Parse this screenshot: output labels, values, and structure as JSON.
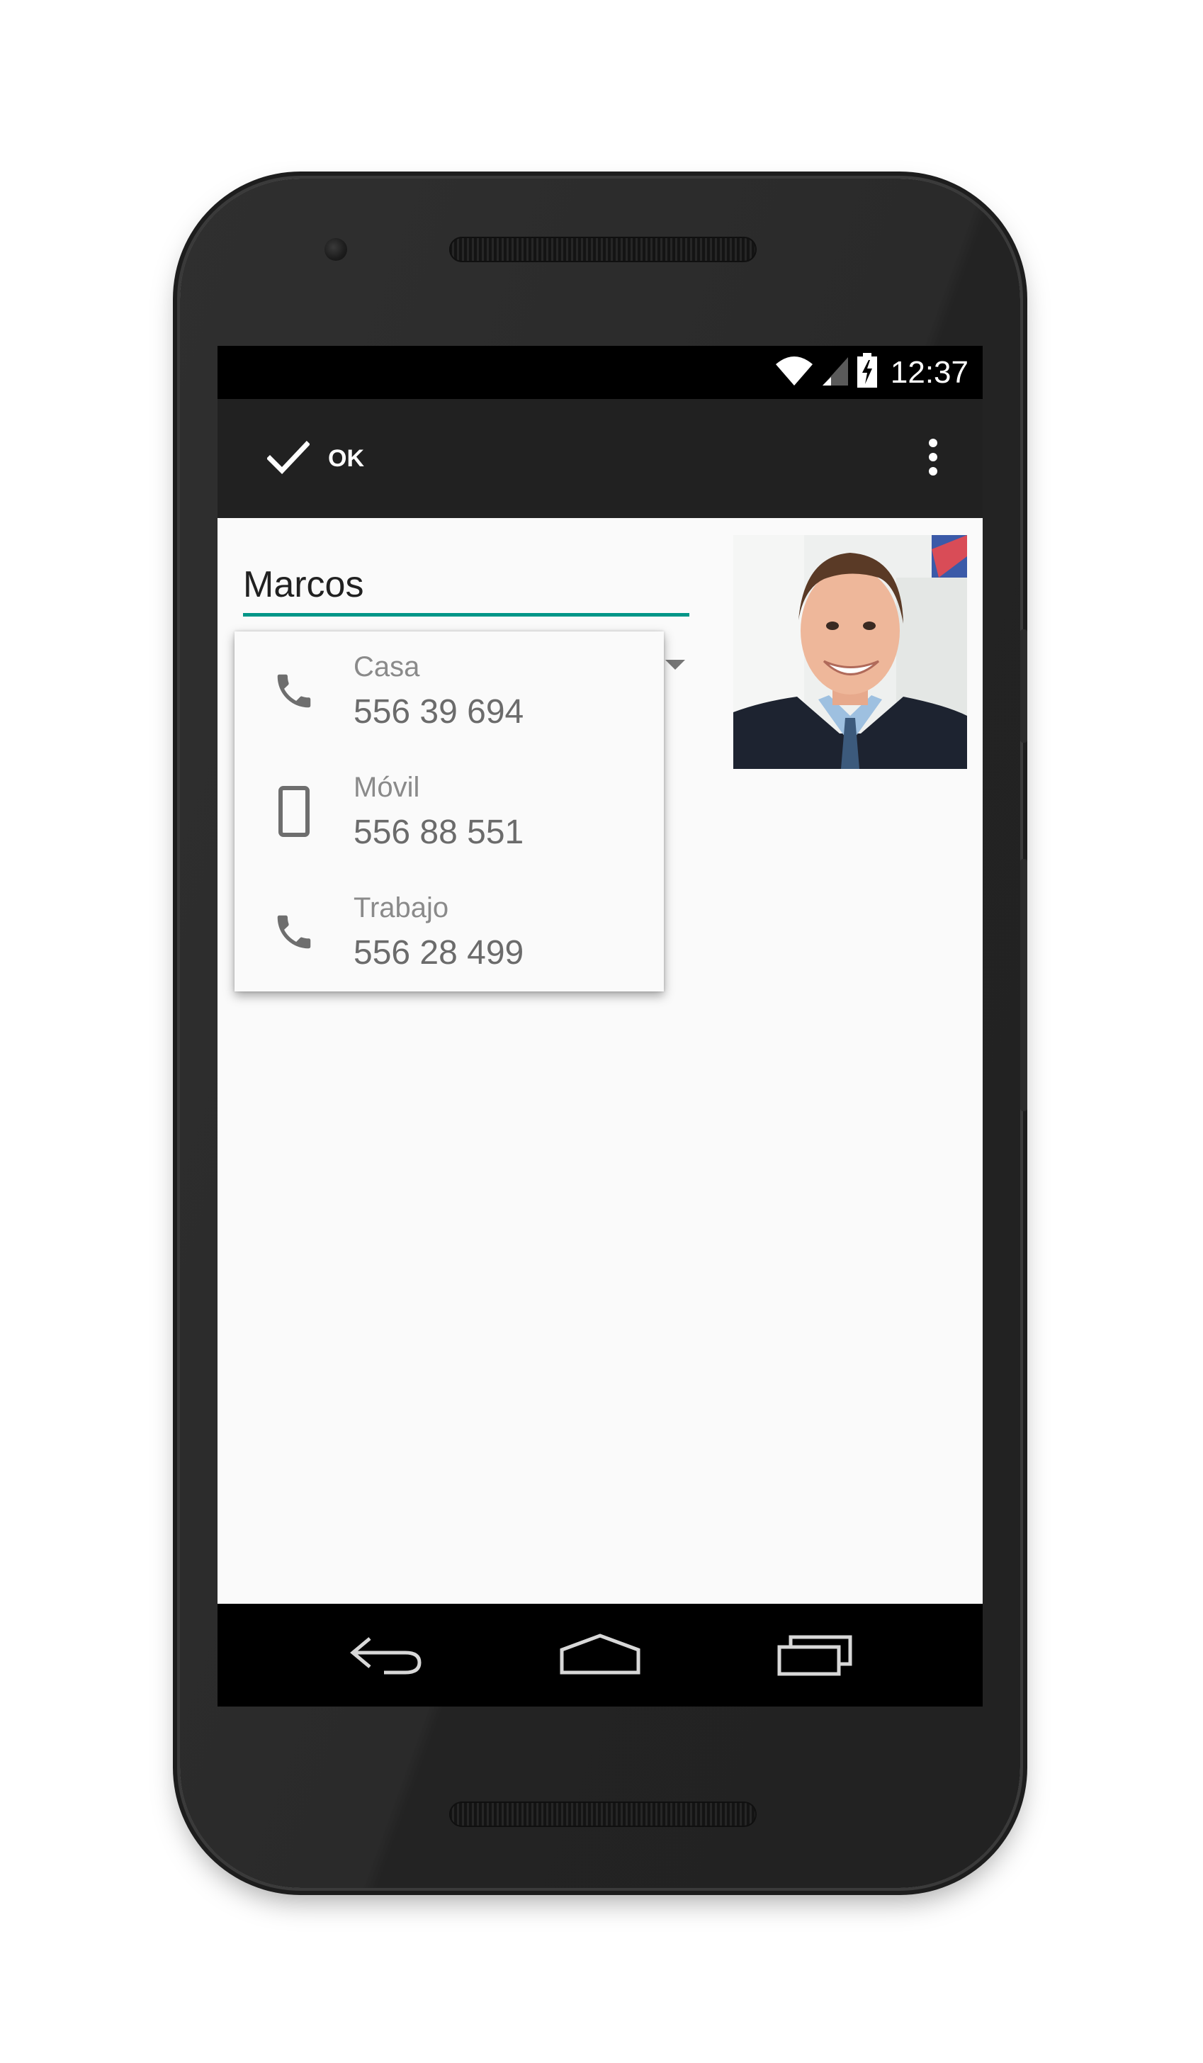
{
  "status_bar": {
    "time": "12:37",
    "icons": [
      "wifi-icon",
      "cell-signal-icon",
      "battery-charging-icon"
    ]
  },
  "action_bar": {
    "ok_label": "OK",
    "ok_icon": "check-icon",
    "overflow_icon": "more-vert-icon"
  },
  "contact": {
    "name": "Marcos",
    "photo_icon": "contact-photo",
    "spinner_icon": "dropdown-arrow-icon"
  },
  "phone_menu": {
    "items": [
      {
        "label": "Casa",
        "number": "556 39 694",
        "icon": "phone-icon"
      },
      {
        "label": "Móvil",
        "number": "556 88 551",
        "icon": "smartphone-icon"
      },
      {
        "label": "Trabajo",
        "number": "556 28 499",
        "icon": "phone-icon"
      }
    ]
  },
  "nav_bar": {
    "icons": [
      "back-icon",
      "home-icon",
      "recents-icon"
    ]
  },
  "colors": {
    "accent": "#009688",
    "action_bar": "#212121",
    "status_bar": "#000000",
    "background": "#fafafa"
  }
}
